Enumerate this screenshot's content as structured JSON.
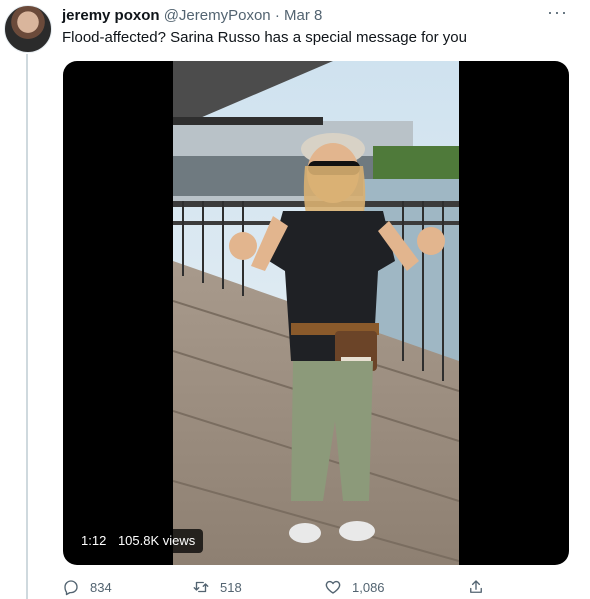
{
  "tweet": {
    "display_name": "jeremy poxon",
    "handle": "@JeremyPoxon",
    "separator": "·",
    "date": "Mar 8",
    "text": "Flood-affected? Sarina Russo has a special message for you",
    "more_icon": "more-icon",
    "more_label": "···"
  },
  "media": {
    "duration": "1:12",
    "views": "105.8K views"
  },
  "actions": {
    "replies": "834",
    "retweets": "518",
    "likes": "1,086",
    "icons": [
      "reply-icon",
      "retweet-icon",
      "like-icon",
      "share-icon"
    ]
  },
  "colors": {
    "secondary_text": "#536471",
    "thread_line": "#cfd9de",
    "media_bg": "#000000"
  }
}
